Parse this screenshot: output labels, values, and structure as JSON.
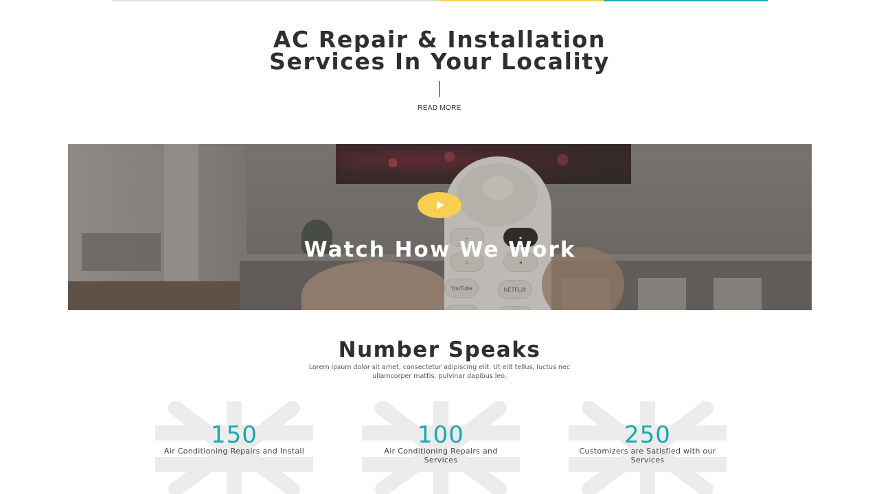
{
  "colors": {
    "top_line_gray": "#e0e0e0",
    "top_line_yellow": "#f7d34a",
    "top_line_teal": "#1aa8b2",
    "accent_teal": "#1aa8b2",
    "play_yellow": "#f9cf4f",
    "snowflake_gray": "#ececec"
  },
  "hero": {
    "title_line1": "AC Repair & Installation",
    "title_line2": "Services In Your Locality",
    "read_more": "READ MORE"
  },
  "video": {
    "title": "Watch How We Work",
    "play_icon": "play-icon",
    "remote_labels": {
      "youtube": "YouTube",
      "netflix": "NETFLIX"
    }
  },
  "numbers": {
    "title": "Number Speaks",
    "description": "Lorem ipsum dolor sit amet, consectetur adipiscing elit. Ut elit tellus, luctus nec ullamcorper mattis, pulvinar dapibus leo.",
    "stats": [
      {
        "value": "150",
        "label": "Air Conditioning Repairs and Install"
      },
      {
        "value": "100",
        "label": "Air Conditioning Repairs and Services"
      },
      {
        "value": "250",
        "label": "Customizers are Satisfied with our Services"
      }
    ]
  }
}
